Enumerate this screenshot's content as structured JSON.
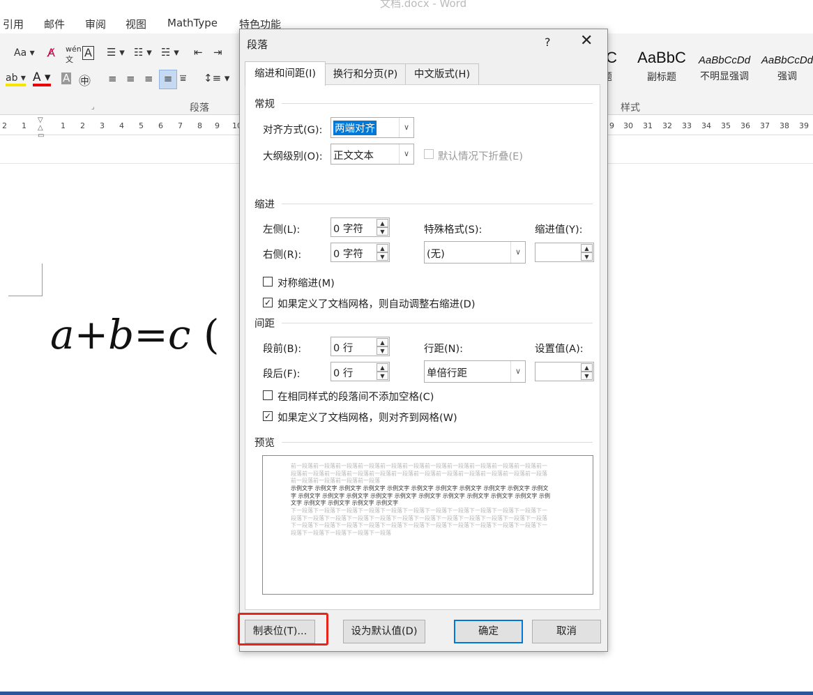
{
  "window_title": "文档.docx - Word",
  "ribbon_tabs": [
    "引用",
    "邮件",
    "审阅",
    "视图",
    "MathType",
    "特色功能"
  ],
  "ribbon": {
    "font_aa_label": "Aa",
    "group_paragraph": "段落",
    "group_styles": "样式",
    "styles": [
      {
        "sample": "bC",
        "name": "题"
      },
      {
        "sample": "AaBbC",
        "name": "副标题"
      },
      {
        "sample": "AaBbCcDd",
        "name": "不明显强调"
      },
      {
        "sample": "AaBbCcDd",
        "name": "强调"
      }
    ]
  },
  "ruler": {
    "left_numbers": [
      "2",
      "1",
      "1",
      "2",
      "3",
      "4",
      "5",
      "6",
      "7",
      "8",
      "9",
      "10"
    ],
    "right_numbers": [
      "9",
      "30",
      "31",
      "32",
      "33",
      "34",
      "35",
      "36",
      "37",
      "38",
      "39"
    ]
  },
  "document": {
    "equation": "a+b=c",
    "trailing": "("
  },
  "dialog": {
    "title": "段落",
    "help": "?",
    "close": "✕",
    "tabs": [
      "缩进和间距(I)",
      "换行和分页(P)",
      "中文版式(H)"
    ],
    "general": {
      "section": "常规",
      "alignment_label": "对齐方式(G):",
      "alignment_value": "两端对齐",
      "outline_label": "大纲级别(O):",
      "outline_value": "正文文本",
      "collapse_label": "默认情况下折叠(E)"
    },
    "indent": {
      "section": "缩进",
      "left_label": "左侧(L):",
      "left_value": "0 字符",
      "right_label": "右侧(R):",
      "right_value": "0 字符",
      "special_label": "特殊格式(S):",
      "special_value": "(无)",
      "by_label": "缩进值(Y):",
      "by_value": "",
      "mirror_label": "对称缩进(M)",
      "mirror_checked": false,
      "auto_right_label": "如果定义了文档网格，则自动调整右缩进(D)",
      "auto_right_checked": true
    },
    "spacing": {
      "section": "间距",
      "before_label": "段前(B):",
      "before_value": "0 行",
      "after_label": "段后(F):",
      "after_value": "0 行",
      "line_label": "行距(N):",
      "line_value": "单倍行距",
      "at_label": "设置值(A):",
      "at_value": "",
      "no_space_label": "在相同样式的段落间不添加空格(C)",
      "no_space_checked": false,
      "snap_label": "如果定义了文档网格，则对齐到网格(W)",
      "snap_checked": true
    },
    "preview": {
      "section": "预览",
      "prev_text": "前一段落前一段落前一段落前一段落前一段落前一段落前一段落前一段落前一段落前一段落前一段落前一段落前一段落前一段落前一段落前一段落前一段落前一段落前一段落前一段落前一段落前一段落前一段落前一段落前一段落前一段落前一段落",
      "sample_text": "示例文字 示例文字 示例文字 示例文字 示例文字 示例文字 示例文字 示例文字 示例文字 示例文字 示例文字 示例文字 示例文字 示例文字 示例文字 示例文字 示例文字 示例文字 示例文字 示例文字 示例文字 示例文字 示例文字 示例文字 示例文字 示例文字",
      "next_text": "下一段落下一段落下一段落下一段落下一段落下一段落下一段落下一段落下一段落下一段落下一段落下一段落下一段落下一段落下一段落下一段落下一段落下一段落下一段落下一段落下一段落下一段落下一段落下一段落下一段落下一段落下一段落下一段落下一段落下一段落下一段落下一段落下一段落下一段落下一段落下一段落下一段落下一段落下一段落"
    },
    "buttons": {
      "tabs": "制表位(T)...",
      "set_default": "设为默认值(D)",
      "ok": "确定",
      "cancel": "取消"
    }
  },
  "colors": {
    "accent": "#0078d7",
    "highlight_box": "#e8231a",
    "word_blue": "#2b579a"
  }
}
